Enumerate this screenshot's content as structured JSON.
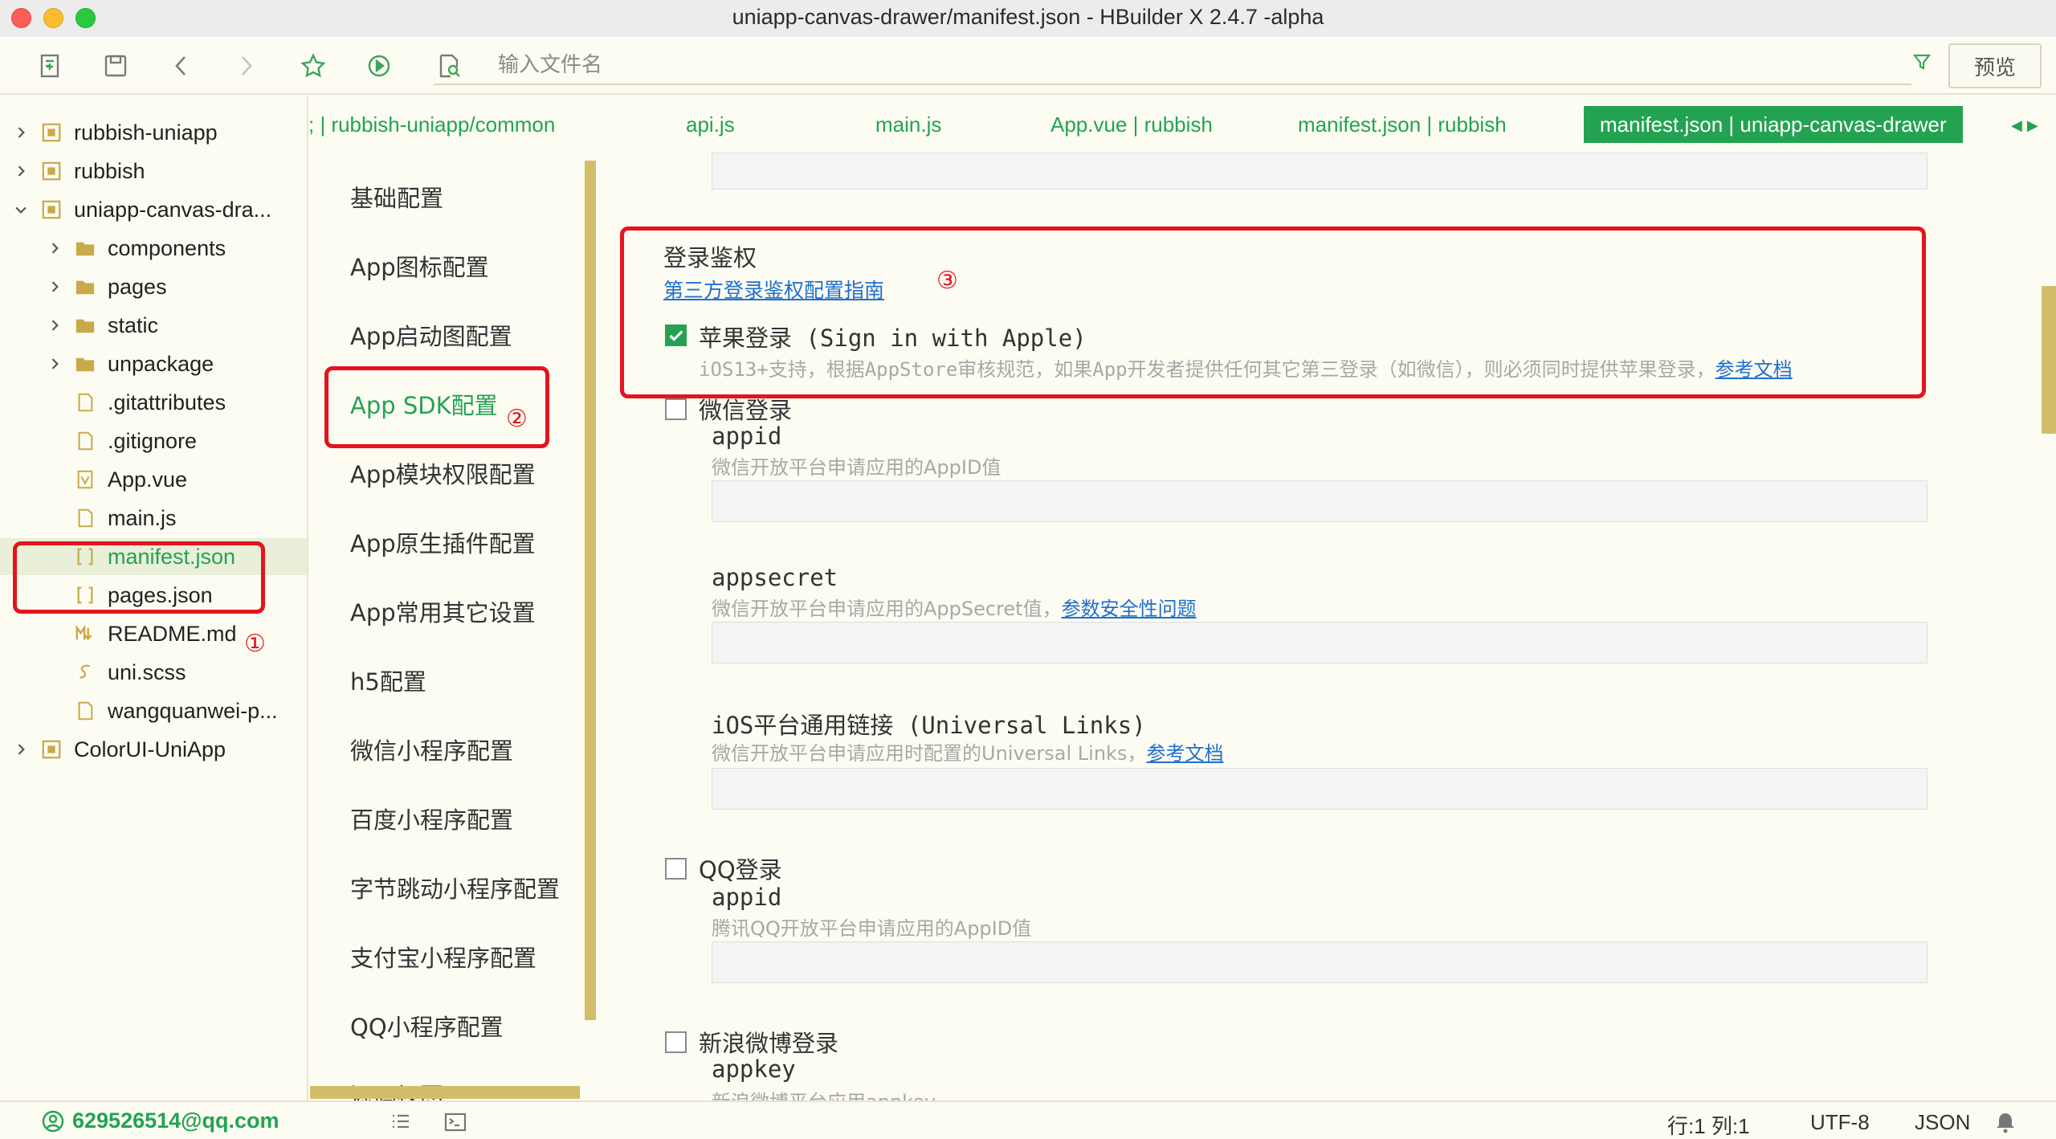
{
  "window": {
    "title": "uniapp-canvas-drawer/manifest.json - HBuilder X 2.4.7 -alpha"
  },
  "toolbar": {
    "search_placeholder": "输入文件名",
    "preview_label": "预览"
  },
  "file_tree": {
    "items": [
      {
        "label": "rubbish-uniapp",
        "icon": "project-icon",
        "expanded": false
      },
      {
        "label": "rubbish",
        "icon": "project-icon",
        "expanded": false
      },
      {
        "label": "uniapp-canvas-dra...",
        "icon": "project-icon",
        "expanded": true
      },
      {
        "label": "components",
        "icon": "folder-icon",
        "expanded": false
      },
      {
        "label": "pages",
        "icon": "folder-icon",
        "expanded": false
      },
      {
        "label": "static",
        "icon": "folder-icon",
        "expanded": false
      },
      {
        "label": "unpackage",
        "icon": "folder-icon",
        "expanded": false
      },
      {
        "label": ".gitattributes",
        "icon": "file-icon"
      },
      {
        "label": ".gitignore",
        "icon": "file-icon"
      },
      {
        "label": "App.vue",
        "icon": "vue-file-icon"
      },
      {
        "label": "main.js",
        "icon": "js-file-icon"
      },
      {
        "label": "manifest.json",
        "icon": "json-file-icon",
        "selected": true
      },
      {
        "label": "pages.json",
        "icon": "json-file-icon"
      },
      {
        "label": "README.md",
        "icon": "markdown-file-icon"
      },
      {
        "label": "uni.scss",
        "icon": "scss-file-icon"
      },
      {
        "label": "wangquanwei-p...",
        "icon": "file-icon"
      },
      {
        "label": "ColorUI-UniApp",
        "icon": "project-icon",
        "expanded": false
      }
    ]
  },
  "tabs": [
    {
      "label": "; | rubbish-uniapp/common"
    },
    {
      "label": "api.js"
    },
    {
      "label": "main.js"
    },
    {
      "label": "App.vue | rubbish"
    },
    {
      "label": "manifest.json | rubbish"
    },
    {
      "label": "manifest.json | uniapp-canvas-drawer",
      "active": true
    }
  ],
  "config_nav": [
    {
      "label": "基础配置"
    },
    {
      "label": "App图标配置"
    },
    {
      "label": "App启动图配置"
    },
    {
      "label": "App  SDK配置",
      "active": true
    },
    {
      "label": "App模块权限配置"
    },
    {
      "label": "App原生插件配置"
    },
    {
      "label": "App常用其它设置"
    },
    {
      "label": "h5配置"
    },
    {
      "label": "微信小程序配置"
    },
    {
      "label": "百度小程序配置"
    },
    {
      "label": "字节跳动小程序配置"
    },
    {
      "label": "支付宝小程序配置"
    },
    {
      "label": "QQ小程序配置"
    },
    {
      "label": "源码视图"
    }
  ],
  "form": {
    "login_section_title": "登录鉴权",
    "login_guide_link": "第三方登录鉴权配置指南",
    "apple": {
      "label": "苹果登录 (Sign in with Apple)",
      "checked": true,
      "hint": "iOS13+支持，根据AppStore审核规范，如果App开发者提供任何其它第三登录（如微信），则必须同时提供苹果登录，",
      "hint_link": "参考文档"
    },
    "weixin": {
      "label": "微信登录",
      "checked": false,
      "appid_label": "appid",
      "appid_hint": "微信开放平台申请应用的AppID值",
      "appid_value": "",
      "appsecret_label": "appsecret",
      "appsecret_hint": "微信开放平台申请应用的AppSecret值，",
      "appsecret_link": "参数安全性问题",
      "appsecret_value": "",
      "ulink_label": "iOS平台通用链接 (Universal Links)",
      "ulink_hint": "微信开放平台申请应用时配置的Universal Links，",
      "ulink_link": "参考文档",
      "ulink_value": ""
    },
    "qq": {
      "label": "QQ登录",
      "checked": false,
      "appid_label": "appid",
      "appid_hint": "腾讯QQ开放平台申请应用的AppID值",
      "appid_value": ""
    },
    "weibo": {
      "label": "新浪微博登录",
      "checked": false,
      "appkey_label": "appkey",
      "appkey_hint": "新浪微博平台应用appkey"
    }
  },
  "annotations": {
    "one": "①",
    "two": "②",
    "three": "③"
  },
  "statusbar": {
    "user": "629526514@qq.com",
    "position": "行:1   列:1",
    "encoding": "UTF-8",
    "language": "JSON"
  },
  "colors": {
    "accent": "#23a352",
    "annotation": "#e3141b",
    "scrollbar": "#d4bd6a",
    "link": "#1f6fd1"
  }
}
